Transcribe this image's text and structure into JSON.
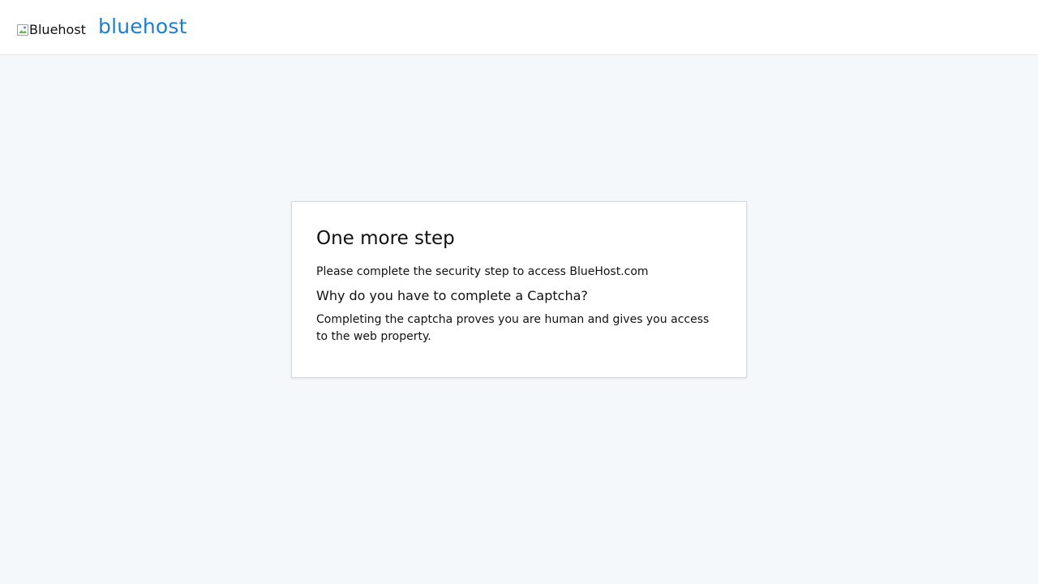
{
  "header": {
    "logo_alt": "Bluehost",
    "brand_text": "bluehost"
  },
  "card": {
    "title": "One more step",
    "intro": "Please complete the security step to access BlueHost.com",
    "question": "Why do you have to complete a Captcha?",
    "explanation": "Completing the captcha proves you are human and gives you access to the web property."
  },
  "colors": {
    "brand": "#1a7fd4",
    "background": "#f5f8fb"
  }
}
